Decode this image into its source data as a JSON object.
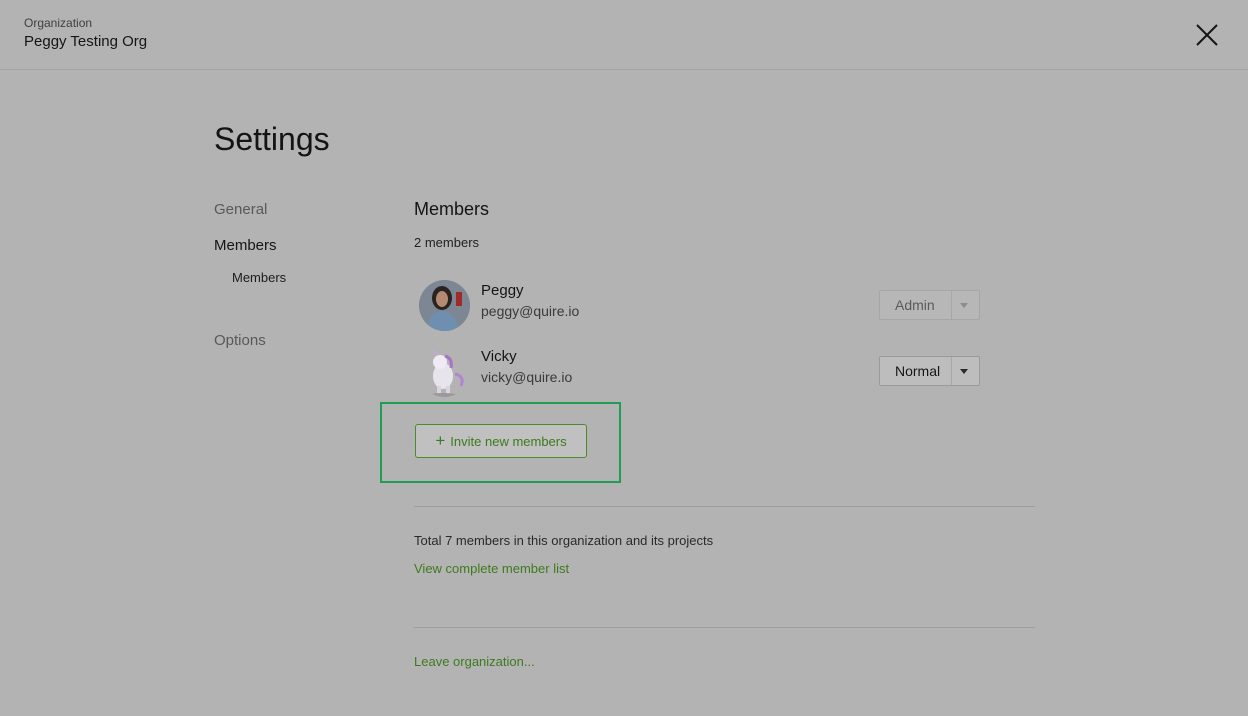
{
  "header": {
    "org_label": "Organization",
    "org_name": "Peggy Testing Org",
    "close_icon": "close-icon"
  },
  "page": {
    "title": "Settings"
  },
  "sidebar": {
    "items": [
      {
        "label": "General"
      },
      {
        "label": "Members"
      },
      {
        "label": "Members"
      },
      {
        "label": "Options"
      }
    ]
  },
  "members": {
    "title": "Members",
    "count": "2 members",
    "list": [
      {
        "name": "Peggy",
        "email": "peggy@quire.io",
        "role": "Admin",
        "avatar": "user-photo-avatar"
      },
      {
        "name": "Vicky",
        "email": "vicky@quire.io",
        "role": "Normal",
        "avatar": "unicorn-avatar"
      }
    ],
    "invite_label": "Invite new members",
    "total_text": "Total 7 members in this organization and its projects",
    "view_list_label": "View complete member list",
    "leave_label": "Leave organization..."
  },
  "colors": {
    "background": "#b3b3b3",
    "link_green": "#3f7a1e",
    "highlight": "#1f9d55"
  }
}
